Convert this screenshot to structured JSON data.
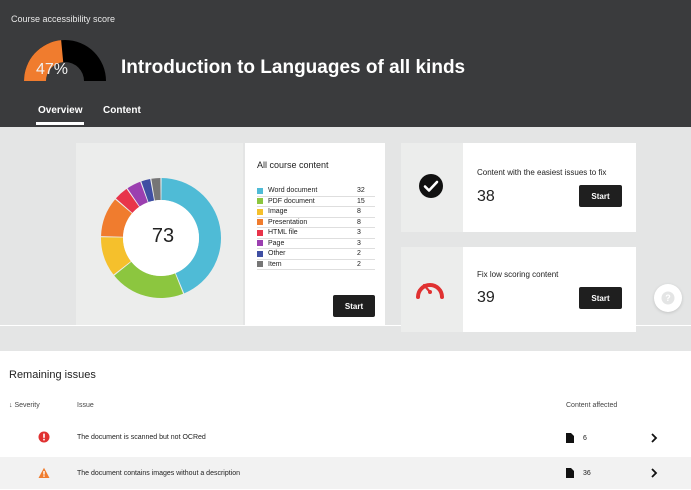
{
  "header": {
    "label": "Course accessibility score",
    "score_percent": "47%",
    "score_value": 47,
    "course_title": "Introduction to Languages of all kinds",
    "tabs": [
      {
        "label": "Overview",
        "active": true
      },
      {
        "label": "Content",
        "active": false
      }
    ]
  },
  "content_summary": {
    "title": "All course content",
    "total": "73",
    "start_label": "Start",
    "items": [
      {
        "label": "Word document",
        "count": "32",
        "color": "#4fbbd6"
      },
      {
        "label": "PDF document",
        "count": "15",
        "color": "#8cc63f"
      },
      {
        "label": "Image",
        "count": "8",
        "color": "#f5c02c"
      },
      {
        "label": "Presentation",
        "count": "8",
        "color": "#f07c2e"
      },
      {
        "label": "HTML file",
        "count": "3",
        "color": "#e8344a"
      },
      {
        "label": "Page",
        "count": "3",
        "color": "#9b3fb0"
      },
      {
        "label": "Other",
        "count": "2",
        "color": "#3f4fa3"
      },
      {
        "label": "Item",
        "count": "2",
        "color": "#767676"
      }
    ]
  },
  "tiles": {
    "easiest": {
      "title": "Content with the easiest issues to fix",
      "count": "38",
      "start_label": "Start",
      "icon": "check-circle-icon"
    },
    "low_score": {
      "title": "Fix low scoring content",
      "count": "39",
      "start_label": "Start",
      "icon": "speedometer-icon"
    }
  },
  "issues": {
    "title": "Remaining issues",
    "columns": {
      "severity": "↓ Severity",
      "issue": "Issue",
      "affected": "Content affected"
    },
    "rows": [
      {
        "severity": "severe",
        "icon": "error-circle-icon",
        "text": "The document is scanned but not OCRed",
        "count": "6"
      },
      {
        "severity": "major",
        "icon": "warning-triangle-icon",
        "text": "The document contains images without a description",
        "count": "36"
      }
    ]
  },
  "colors": {
    "header_bg": "#3a3b3d",
    "score_fill": "#f07c2e",
    "error": "#e03131",
    "warning": "#f07c2e"
  }
}
